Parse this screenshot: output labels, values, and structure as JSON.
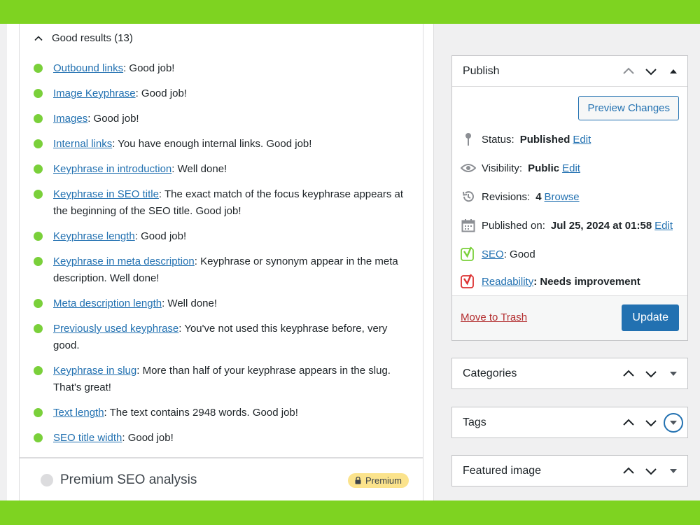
{
  "results": {
    "title": "Good results (13)",
    "items": [
      {
        "link": "Outbound links",
        "text": ": Good job!"
      },
      {
        "link": "Image Keyphrase",
        "text": ": Good job!"
      },
      {
        "link": "Images",
        "text": ": Good job!"
      },
      {
        "link": "Internal links",
        "text": ": You have enough internal links. Good job!"
      },
      {
        "link": "Keyphrase in introduction",
        "text": ": Well done!"
      },
      {
        "link": "Keyphrase in SEO title",
        "text": ": The exact match of the focus keyphrase appears at the beginning of the SEO title. Good job!"
      },
      {
        "link": "Keyphrase length",
        "text": ": Good job!"
      },
      {
        "link": "Keyphrase in meta description",
        "text": ": Keyphrase or synonym appear in the meta description. Well done!"
      },
      {
        "link": "Meta description length",
        "text": ": Well done!"
      },
      {
        "link": "Previously used keyphrase",
        "text": ": You've not used this keyphrase before, very good."
      },
      {
        "link": "Keyphrase in slug",
        "text": ": More than half of your keyphrase appears in the slug. That's great!"
      },
      {
        "link": "Text length",
        "text": ": The text contains 2948 words. Good job!"
      },
      {
        "link": "SEO title width",
        "text": ": Good job!"
      }
    ]
  },
  "premium": {
    "title": "Premium SEO analysis",
    "badge": "Premium"
  },
  "publish": {
    "title": "Publish",
    "preview_label": "Preview Changes",
    "status_label": "Status: ",
    "status_value": "Published",
    "status_edit": "Edit",
    "visibility_label": "Visibility: ",
    "visibility_value": "Public",
    "visibility_edit": "Edit",
    "revisions_label": "Revisions: ",
    "revisions_value": "4",
    "revisions_link": "Browse",
    "published_label": "Published on: ",
    "published_value": "Jul 25, 2024 at 01:58",
    "published_edit": "Edit",
    "seo_link": "SEO",
    "seo_value": ": Good",
    "readability_link": "Readability",
    "readability_value": ": Needs improvement",
    "trash_label": "Move to Trash",
    "update_label": "Update"
  },
  "boxes": {
    "categories": "Categories",
    "tags": "Tags",
    "featured": "Featured image"
  },
  "colors": {
    "accent": "#2271b1",
    "good": "#7ad03a",
    "bad": "#dc3232",
    "frame": "#7ed321",
    "premium_badge": "#fbe38c"
  }
}
